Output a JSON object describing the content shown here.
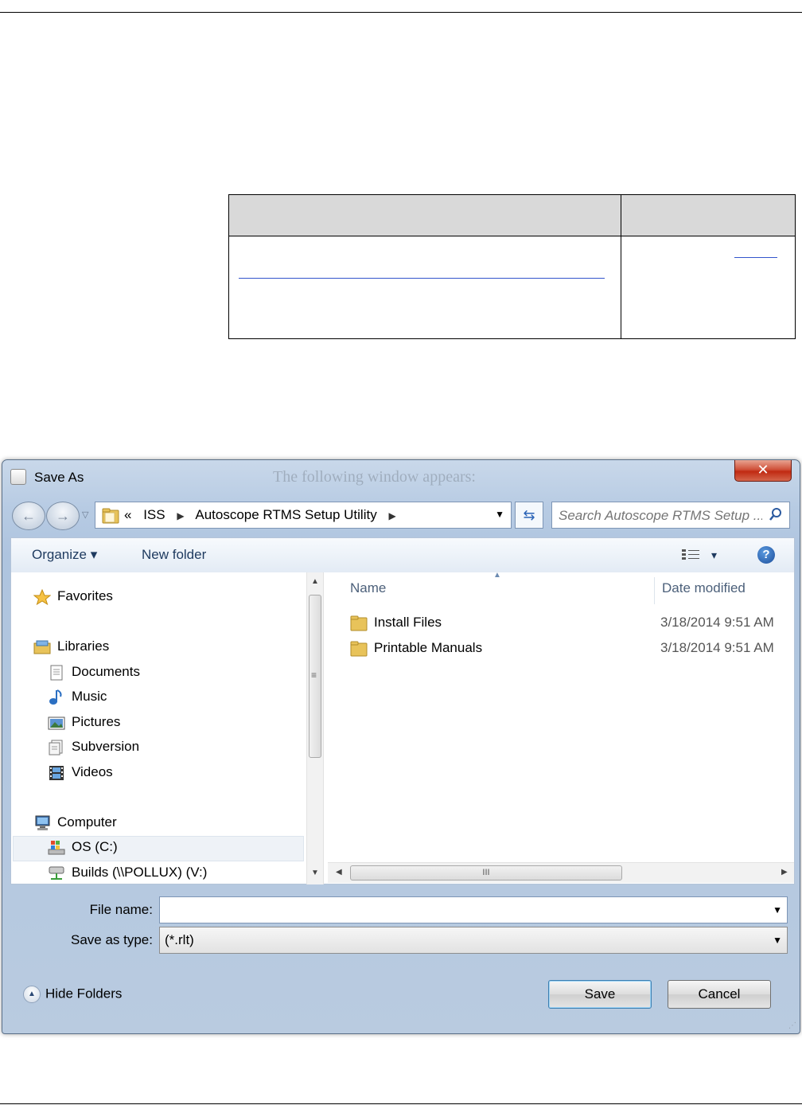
{
  "dialog": {
    "title": "Save As",
    "close_label": "✕",
    "background_text": "The following window appears:"
  },
  "navigation": {
    "back_label": "←",
    "forward_label": "→",
    "breadcrumb": [
      "«",
      "ISS",
      "Autoscope RTMS Setup Utility"
    ],
    "search_placeholder": "Search Autoscope RTMS Setup ..."
  },
  "toolbar": {
    "organize_label": "Organize ▾",
    "new_folder_label": "New folder",
    "view_label": "▾",
    "help_label": "?"
  },
  "nav_pane": {
    "favorites": "Favorites",
    "libraries": "Libraries",
    "library_items": [
      "Documents",
      "Music",
      "Pictures",
      "Subversion",
      "Videos"
    ],
    "computer": "Computer",
    "drives": [
      "OS (C:)",
      "Builds (\\\\POLLUX) (V:)"
    ]
  },
  "file_list": {
    "columns": [
      "Name",
      "Date modified"
    ],
    "rows": [
      {
        "name": "Install Files",
        "date": "3/18/2014 9:51 AM"
      },
      {
        "name": "Printable Manuals",
        "date": "3/18/2014 9:51 AM"
      }
    ],
    "hscroll_grip": "III"
  },
  "form": {
    "file_name_label": "File name:",
    "file_name_value": "",
    "save_as_type_label": "Save as type:",
    "save_as_type_value": "(*.rlt)"
  },
  "footer": {
    "hide_folders_label": "Hide Folders",
    "save_label": "Save",
    "cancel_label": "Cancel"
  }
}
